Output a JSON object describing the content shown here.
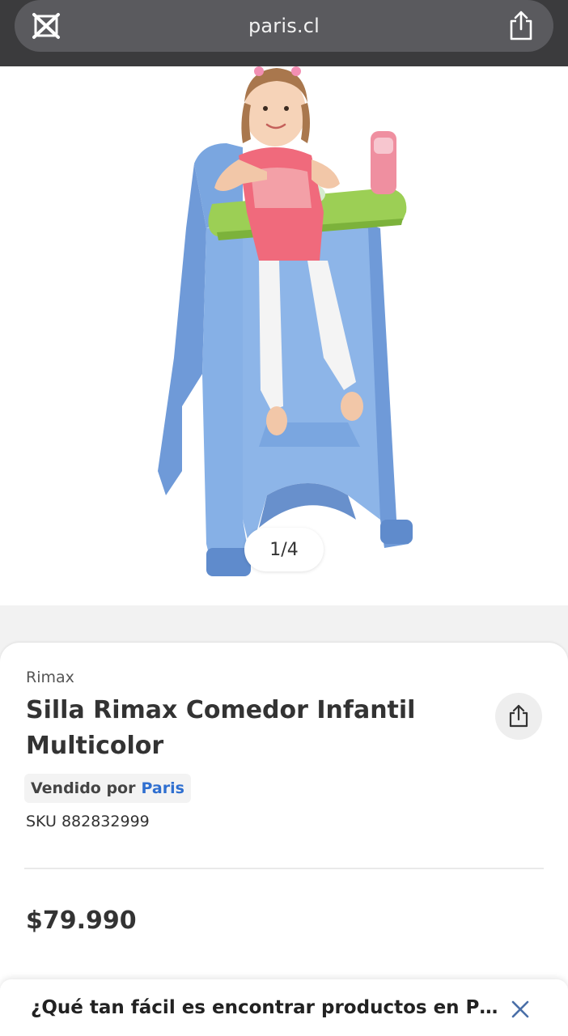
{
  "browser": {
    "url": "paris.cl",
    "tab_icon": "tab-close-icon",
    "share_icon": "share-icon"
  },
  "gallery": {
    "counter": "1/4"
  },
  "product": {
    "brand": "Rimax",
    "title": "Silla Rimax Comedor Infantil Multicolor",
    "seller_prefix": "Vendido por",
    "seller_name": "Paris",
    "sku": "SKU 882832999",
    "price": "$79.990"
  },
  "survey": {
    "text": "¿Qué tan fácil es encontrar productos en P…"
  },
  "colors": {
    "accent_link": "#2f6fd0",
    "browser_bar": "#3b3b3d"
  }
}
